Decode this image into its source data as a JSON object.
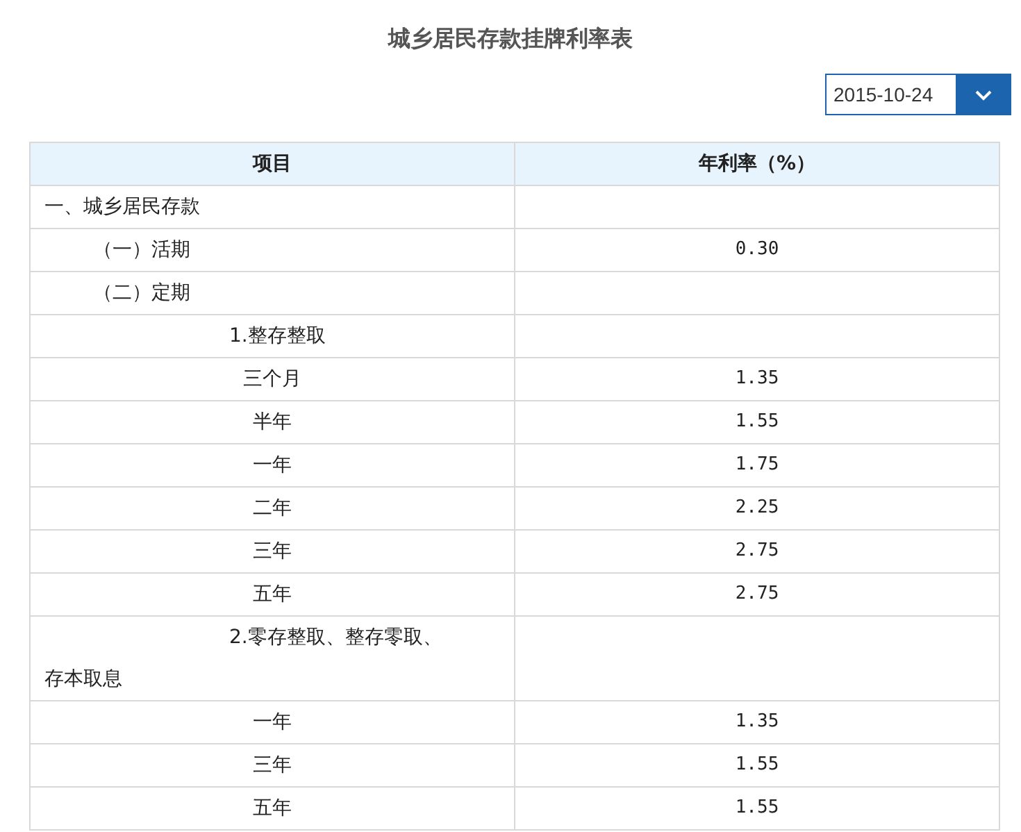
{
  "title": "城乡居民存款挂牌利率表",
  "date_select": {
    "value": "2015-10-24"
  },
  "table": {
    "columns": [
      "项目",
      "年利率（%）"
    ],
    "rows": [
      {
        "kind": "level1",
        "item": "一、城乡居民存款"
      },
      {
        "kind": "level2",
        "item": "（一）活期",
        "rate": "0.30"
      },
      {
        "kind": "level2",
        "item": "（二）定期"
      },
      {
        "kind": "level3",
        "item": "1.整存整取"
      },
      {
        "kind": "term",
        "item": "三个月",
        "rate": "1.35"
      },
      {
        "kind": "term",
        "item": "半年",
        "rate": "1.55"
      },
      {
        "kind": "term",
        "item": "一年",
        "rate": "1.75"
      },
      {
        "kind": "term",
        "item": "二年",
        "rate": "2.25"
      },
      {
        "kind": "term",
        "item": "三年",
        "rate": "2.75"
      },
      {
        "kind": "term",
        "item": "五年",
        "rate": "2.75"
      },
      {
        "kind": "level3",
        "item": "2.零存整取、整存零取、存本取息"
      },
      {
        "kind": "term",
        "item": "一年",
        "rate": "1.35"
      },
      {
        "kind": "term",
        "item": "三年",
        "rate": "1.55"
      },
      {
        "kind": "term",
        "item": "五年",
        "rate": "1.55"
      }
    ]
  }
}
